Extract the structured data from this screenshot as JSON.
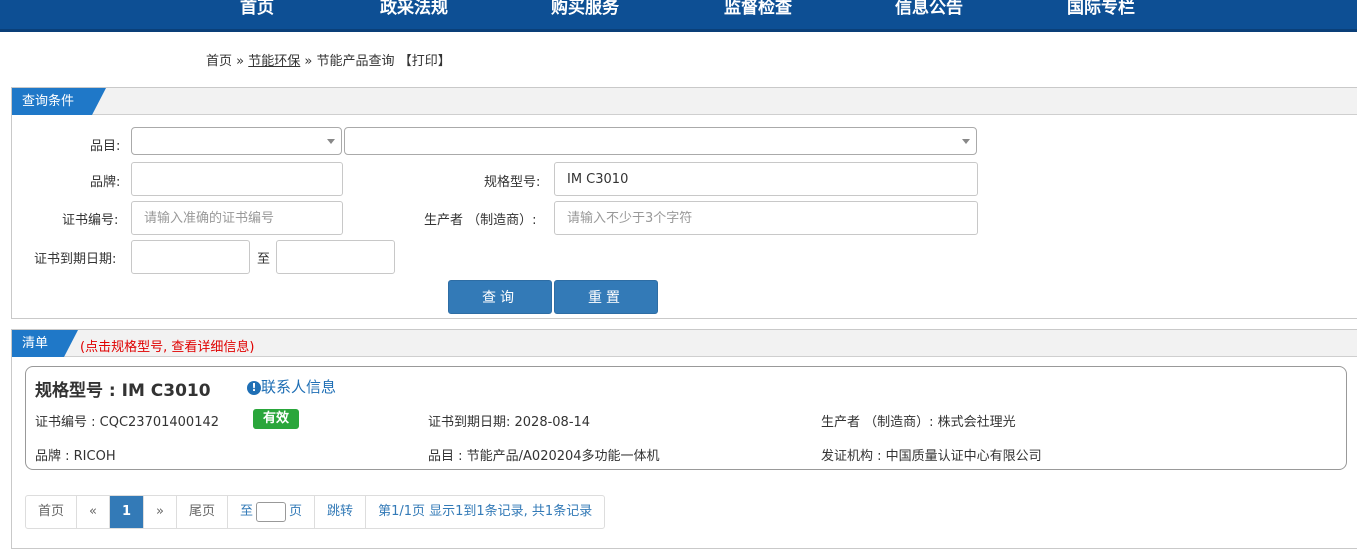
{
  "nav": {
    "items": [
      "首页",
      "政采法规",
      "购买服务",
      "监督检查",
      "信息公告",
      "国际专栏"
    ]
  },
  "breadcrumb": {
    "home": "首页",
    "sep1": "»",
    "section": "节能环保",
    "sep2": "»",
    "current": "节能产品查询",
    "print": "【打印】"
  },
  "query": {
    "tab": "查询条件",
    "category_label": "品目:",
    "brand_label": "品牌:",
    "model_label": "规格型号:",
    "model_value": "IM C3010",
    "cert_no_label": "证书编号:",
    "cert_no_placeholder": "请输入准确的证书编号",
    "manufacturer_label": "生产者 （制造商）:",
    "manufacturer_placeholder": "请输入不少于3个字符",
    "expiry_label": "证书到期日期:",
    "expiry_to": "至",
    "search_button": "查询",
    "reset_button": "重置"
  },
  "results": {
    "tab": "清单",
    "hint": "(点击规格型号, 查看详细信息)",
    "items": [
      {
        "model_title": "规格型号 : IM C3010",
        "contact_label": "联系人信息",
        "cert_no": "证书编号 : CQC23701400142",
        "status": "有效",
        "expiry": "证书到期日期: 2028-08-14",
        "manufacturer": "生产者 （制造商）: 株式会社理光",
        "brand": "品牌 : RICOH",
        "category": "品目 : 节能产品/A020204多功能一体机",
        "issuer": "发证机构 : 中国质量认证中心有限公司"
      }
    ]
  },
  "pager": {
    "first": "首页",
    "prev": "«",
    "current_page": "1",
    "next": "»",
    "last": "尾页",
    "to": "至",
    "page_unit": "页",
    "jump": "跳转",
    "summary": "第1/1页  显示1到1条记录, 共1条记录"
  },
  "colors": {
    "nav_bg": "#0d4f94",
    "tab_blue": "#1f78c8",
    "button_blue": "#337ab7",
    "valid_green": "#2aa63b",
    "hint_red": "#e00000"
  }
}
